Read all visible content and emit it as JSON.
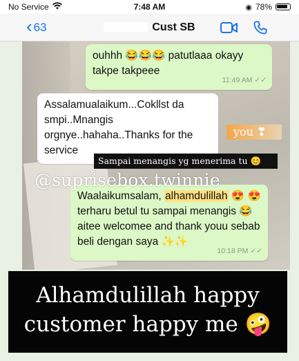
{
  "status_bar": {
    "carrier": "No Service",
    "time": "7:48 AM",
    "battery": "78%"
  },
  "header": {
    "back_count": "63",
    "contact_name": "Cust SB",
    "icons": [
      "video-call-icon",
      "phone-call-icon"
    ]
  },
  "messages": [
    {
      "direction": "outgoing",
      "text": "ouhhh 😂😂😂 patutlaaa okayy takpe takpeee",
      "time": "11:49 AM"
    },
    {
      "direction": "incoming",
      "text": "Assalamualaikum...Cokllst da smpi..Mnangis orgnye..hahaha..Thanks for the service"
    },
    {
      "direction": "outgoing",
      "text_before": "Waalaikumsalam, ",
      "highlight": "alhamdulillah",
      "text_after": " 😍 😍 terharu betul tu sampai menangis 😂 aitee welcomee and thank youu sebab beli dengan saya ✨✨",
      "time": "10:18 PM"
    }
  ],
  "overlays": {
    "sticker": "you ❣",
    "caption": "Sampai menangis yg menerima tu 😊",
    "watermark": "@suprisebox.twinnie"
  },
  "bottom_caption": "Alhamdulillah happy customer happy me 🤪",
  "colors": {
    "outgoing_bubble": "#dcf8c6",
    "incoming_bubble": "#ffffff",
    "accent_blue": "#1a73e8",
    "caption_bg": "#050505"
  }
}
